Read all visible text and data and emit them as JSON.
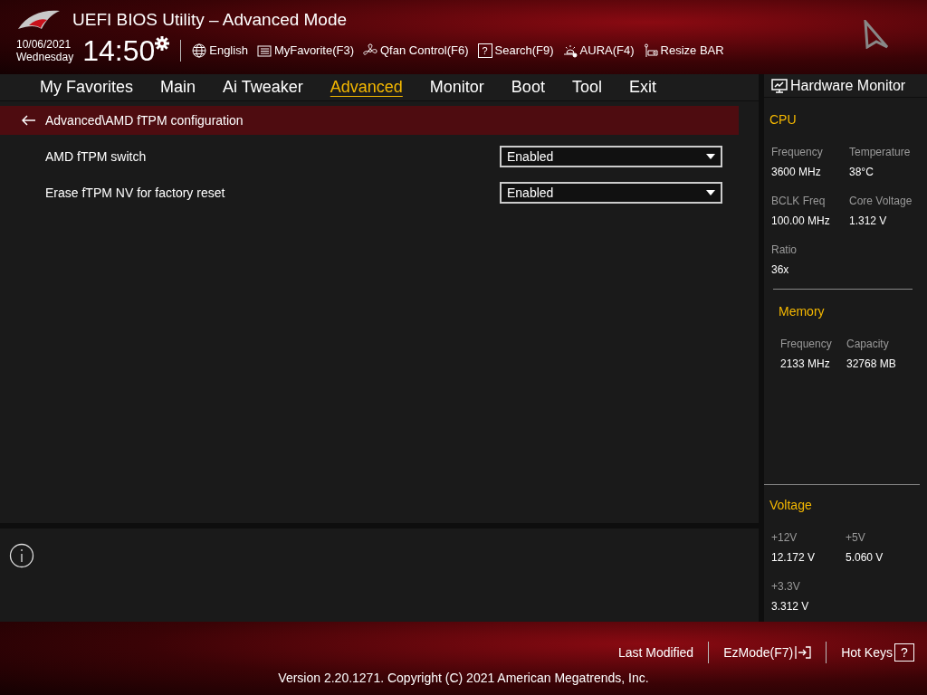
{
  "header": {
    "title": "UEFI BIOS Utility – Advanced Mode",
    "date": "10/06/2021",
    "day": "Wednesday",
    "time": "14:50",
    "tools": [
      {
        "kind": "language",
        "label": "English"
      },
      {
        "kind": "favorite",
        "label": "MyFavorite(F3)"
      },
      {
        "kind": "fan",
        "label": "Qfan Control(F6)"
      },
      {
        "kind": "search",
        "icon_char": "?",
        "label": "Search(F9)"
      },
      {
        "kind": "aura",
        "label": "AURA(F4)"
      },
      {
        "kind": "resizebar",
        "label": "Resize BAR"
      }
    ]
  },
  "tabs": [
    {
      "label": "My Favorites",
      "selected": false
    },
    {
      "label": "Main",
      "selected": false
    },
    {
      "label": "Ai Tweaker",
      "selected": false
    },
    {
      "label": "Advanced",
      "selected": true
    },
    {
      "label": "Monitor",
      "selected": false
    },
    {
      "label": "Boot",
      "selected": false
    },
    {
      "label": "Tool",
      "selected": false
    },
    {
      "label": "Exit",
      "selected": false
    }
  ],
  "breadcrumb": "Advanced\\AMD fTPM configuration",
  "settings": [
    {
      "label": "AMD fTPM switch",
      "value": "Enabled"
    },
    {
      "label": "Erase fTPM NV for factory reset",
      "value": "Enabled"
    }
  ],
  "hardware_monitor": {
    "title": "Hardware Monitor",
    "sections": [
      {
        "title": "CPU",
        "items": [
          {
            "label": "Frequency",
            "value": "3600 MHz"
          },
          {
            "label": "Temperature",
            "value": "38°C"
          },
          {
            "label": "BCLK Freq",
            "value": "100.00 MHz"
          },
          {
            "label": "Core Voltage",
            "value": "1.312 V"
          },
          {
            "label": "Ratio",
            "value": "36x"
          }
        ]
      },
      {
        "title": "Memory",
        "items": [
          {
            "label": "Frequency",
            "value": "2133 MHz"
          },
          {
            "label": "Capacity",
            "value": "32768 MB"
          }
        ]
      },
      {
        "title": "Voltage",
        "items": [
          {
            "label": "+12V",
            "value": "12.172 V"
          },
          {
            "label": "+5V",
            "value": "5.060 V"
          },
          {
            "label": "+3.3V",
            "value": "3.312 V"
          }
        ]
      }
    ]
  },
  "footer": {
    "actions": [
      {
        "kind": "last",
        "label": "Last Modified"
      },
      {
        "kind": "ezmode",
        "label": "EzMode(F7)"
      },
      {
        "kind": "hotkeys",
        "label": "Hot Keys",
        "icon_char": "?"
      }
    ],
    "version": "Version 2.20.1271. Copyright (C) 2021 American Megatrends, Inc."
  }
}
